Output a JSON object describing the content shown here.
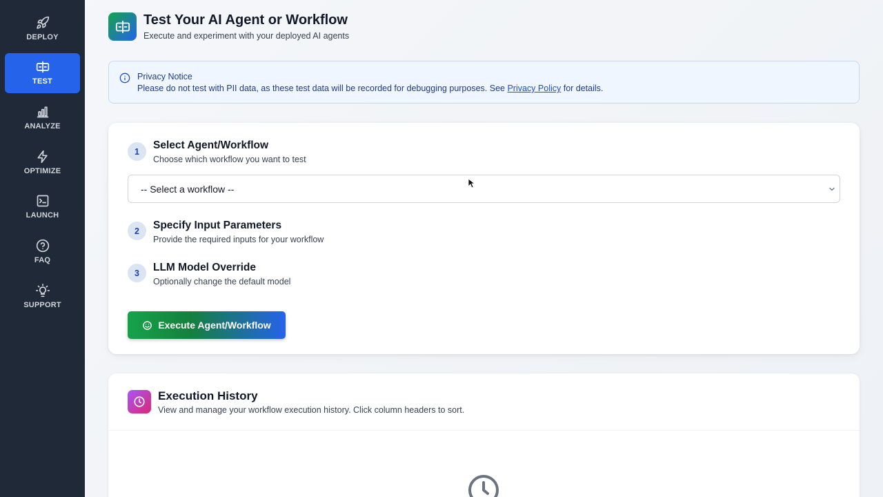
{
  "sidebar": {
    "items": [
      {
        "label": "DEPLOY",
        "icon": "rocket-icon",
        "active": false
      },
      {
        "label": "TEST",
        "icon": "test-icon",
        "active": true
      },
      {
        "label": "ANALYZE",
        "icon": "bar-chart-icon",
        "active": false
      },
      {
        "label": "OPTIMIZE",
        "icon": "lightning-icon",
        "active": false
      },
      {
        "label": "LAUNCH",
        "icon": "terminal-icon",
        "active": false
      },
      {
        "label": "FAQ",
        "icon": "question-icon",
        "active": false
      },
      {
        "label": "SUPPORT",
        "icon": "lightbulb-icon",
        "active": false
      }
    ]
  },
  "header": {
    "title": "Test Your AI Agent or Workflow",
    "subtitle": "Execute and experiment with your deployed AI agents"
  },
  "notice": {
    "title": "Privacy Notice",
    "text_before": "Please do not test with PII data, as these test data will be recorded for debugging purposes. See ",
    "link": "Privacy Policy",
    "text_after": " for details."
  },
  "steps": [
    {
      "num": "1",
      "title": "Select Agent/Workflow",
      "desc": "Choose which workflow you want to test"
    },
    {
      "num": "2",
      "title": "Specify Input Parameters",
      "desc": "Provide the required inputs for your workflow"
    },
    {
      "num": "3",
      "title": "LLM Model Override",
      "desc": "Optionally change the default model"
    }
  ],
  "select": {
    "value": "-- Select a workflow --"
  },
  "execute_button": {
    "label": "Execute Agent/Workflow"
  },
  "history": {
    "title": "Execution History",
    "desc": "View and manage your workflow execution history. Click column headers to sort."
  },
  "colors": {
    "sidebar_bg": "#1f2937",
    "accent": "#2563eb",
    "green": "#16a34a"
  }
}
